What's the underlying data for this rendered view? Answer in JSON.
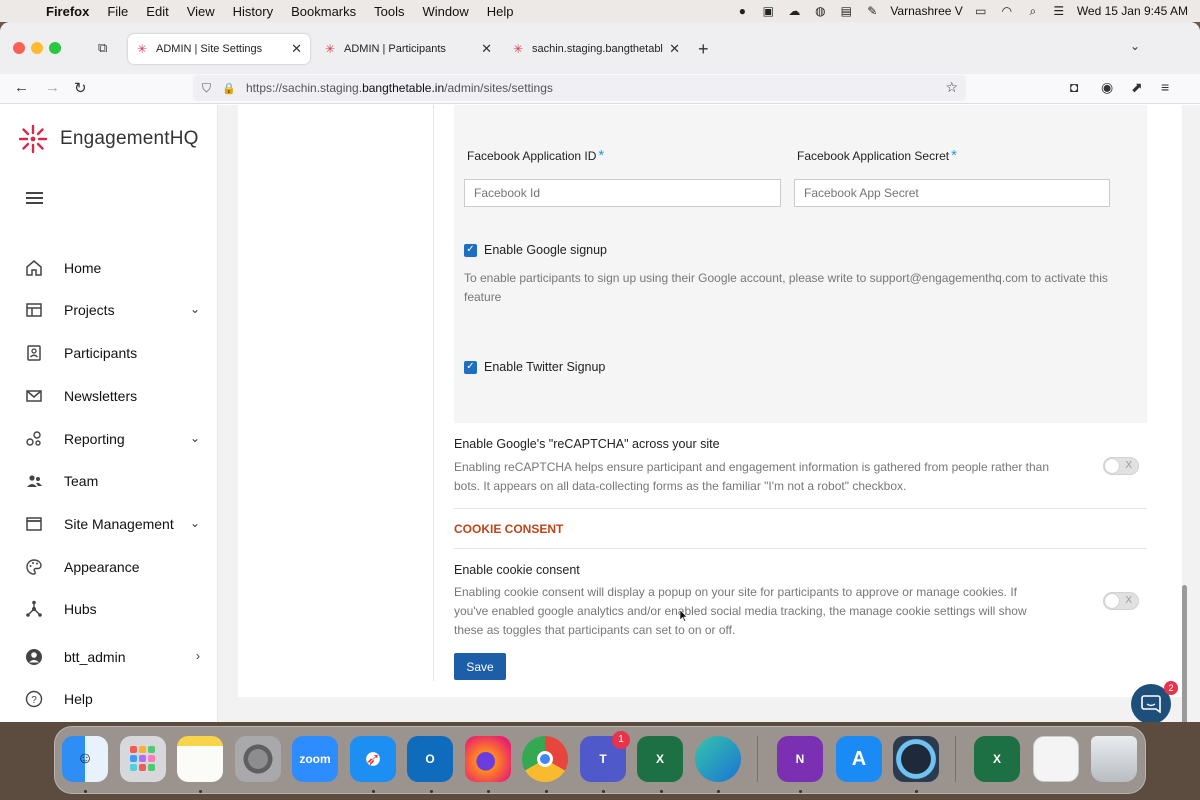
{
  "menubar": {
    "app_name": "Firefox",
    "menus": [
      "File",
      "Edit",
      "View",
      "History",
      "Bookmarks",
      "Tools",
      "Window",
      "Help"
    ],
    "user": "Varnashree V",
    "datetime": "Wed 15 Jan  9:45 AM"
  },
  "tabs": [
    {
      "title": "ADMIN | Site Settings",
      "active": true
    },
    {
      "title": "ADMIN | Participants",
      "active": false
    },
    {
      "title": "sachin.staging.bangthetable.in/",
      "active": false
    }
  ],
  "urlbar": {
    "prefix": "https://sachin.staging.",
    "domain": "bangthetable.in",
    "suffix": "/admin/sites/settings"
  },
  "brand": {
    "name": "EngagementHQ",
    "accent": "#d8294c"
  },
  "sidebar": {
    "items": [
      {
        "label": "Home",
        "icon": "home-icon",
        "has_chevron": false
      },
      {
        "label": "Projects",
        "icon": "projects-icon",
        "has_chevron": true
      },
      {
        "label": "Participants",
        "icon": "participants-icon",
        "has_chevron": false
      },
      {
        "label": "Newsletters",
        "icon": "mail-icon",
        "has_chevron": false
      },
      {
        "label": "Reporting",
        "icon": "reporting-icon",
        "has_chevron": true
      },
      {
        "label": "Team",
        "icon": "team-icon",
        "has_chevron": false
      },
      {
        "label": "Site Management",
        "icon": "site-management-icon",
        "has_chevron": true
      },
      {
        "label": "Appearance",
        "icon": "palette-icon",
        "has_chevron": false
      },
      {
        "label": "Hubs",
        "icon": "hubs-icon",
        "has_chevron": false
      },
      {
        "label": "btt_admin",
        "icon": "user-icon",
        "has_chevron": true
      },
      {
        "label": "Help",
        "icon": "help-icon",
        "has_chevron": false
      }
    ]
  },
  "settings": {
    "facebook_app_id_label": "Facebook Application ID",
    "facebook_app_id_placeholder": "Facebook Id",
    "facebook_app_secret_label": "Facebook Application Secret",
    "facebook_app_secret_placeholder": "Facebook App Secret",
    "required_mark": "*",
    "google_signup_label": "Enable Google signup",
    "google_signup_checked": true,
    "google_signup_help_line1": "To enable participants to sign up using their Google account, please write to support@engagementhq.com to activate this",
    "google_signup_help_line2": "feature",
    "twitter_signup_label": "Enable Twitter Signup",
    "twitter_signup_checked": true,
    "recaptcha_title": "Enable Google's \"reCAPTCHA\" across your site",
    "recaptcha_help_line1": "Enabling reCAPTCHA helps ensure participant and engagement information is gathered from people rather than",
    "recaptcha_help_line2": "bots. It appears on all data-collecting forms as the familiar \"I'm not a robot\" checkbox.",
    "recaptcha_enabled": false,
    "cookie_section": "COOKIE CONSENT",
    "cookie_title": "Enable cookie consent",
    "cookie_help_line1": "Enabling cookie consent will display a popup on your site for participants to approve or manage cookies. If",
    "cookie_help_line2": "you've enabled google analytics and/or enabled social media tracking, the manage cookie settings will show",
    "cookie_help_line3": "these as toggles that participants can set to on or off.",
    "cookie_enabled": false,
    "toggle_off_mark": "X",
    "save_label": "Save"
  },
  "chat": {
    "badge_count": "2"
  },
  "dock": {
    "apps": [
      "Finder",
      "Launchpad",
      "Notes",
      "System Settings",
      "zoom",
      "Safari",
      "Outlook",
      "Firefox",
      "Chrome",
      "Teams",
      "Excel",
      "Edge",
      "OneNote",
      "App Store",
      "QuickTime",
      "Excel",
      "Preview",
      "Trash"
    ],
    "teams_badge": "1"
  }
}
